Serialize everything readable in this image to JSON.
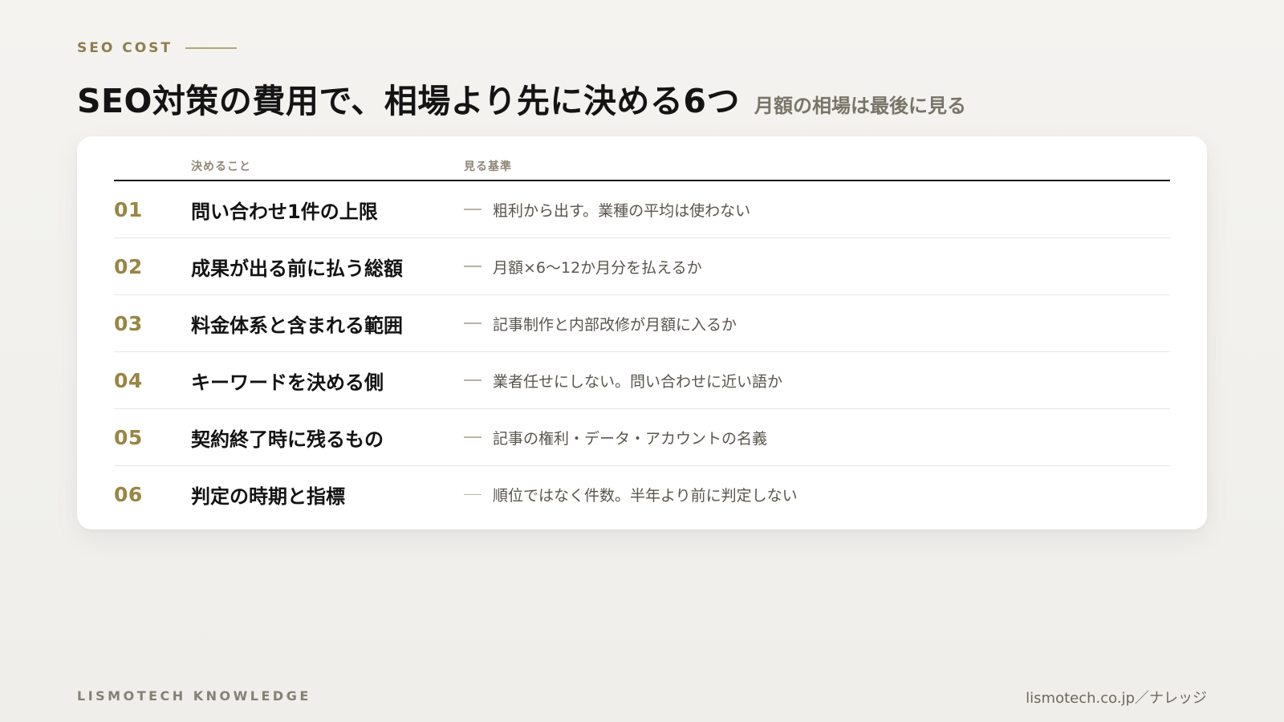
{
  "eyebrow": "SEO COST",
  "title": "SEO対策の費用で、相場より先に決める6つ",
  "subtitle": "月額の相場は最後に見る",
  "table": {
    "headers": {
      "item": "決めること",
      "criteria": "見る基準"
    },
    "rows": [
      {
        "num": "01",
        "item": "問い合わせ1件の上限",
        "criteria": "粗利から出す。業種の平均は使わない"
      },
      {
        "num": "02",
        "item": "成果が出る前に払う総額",
        "criteria": "月額×6〜12か月分を払えるか"
      },
      {
        "num": "03",
        "item": "料金体系と含まれる範囲",
        "criteria": "記事制作と内部改修が月額に入るか"
      },
      {
        "num": "04",
        "item": "キーワードを決める側",
        "criteria": "業者任せにしない。問い合わせに近い語か"
      },
      {
        "num": "05",
        "item": "契約終了時に残るもの",
        "criteria": "記事の権利・データ・アカウントの名義"
      },
      {
        "num": "06",
        "item": "判定の時期と指標",
        "criteria": "順位ではなく件数。半年より前に判定しない"
      }
    ]
  },
  "footer": {
    "brand": "LISMOTECH KNOWLEDGE",
    "url": "lismotech.co.jp／ナレッジ"
  }
}
